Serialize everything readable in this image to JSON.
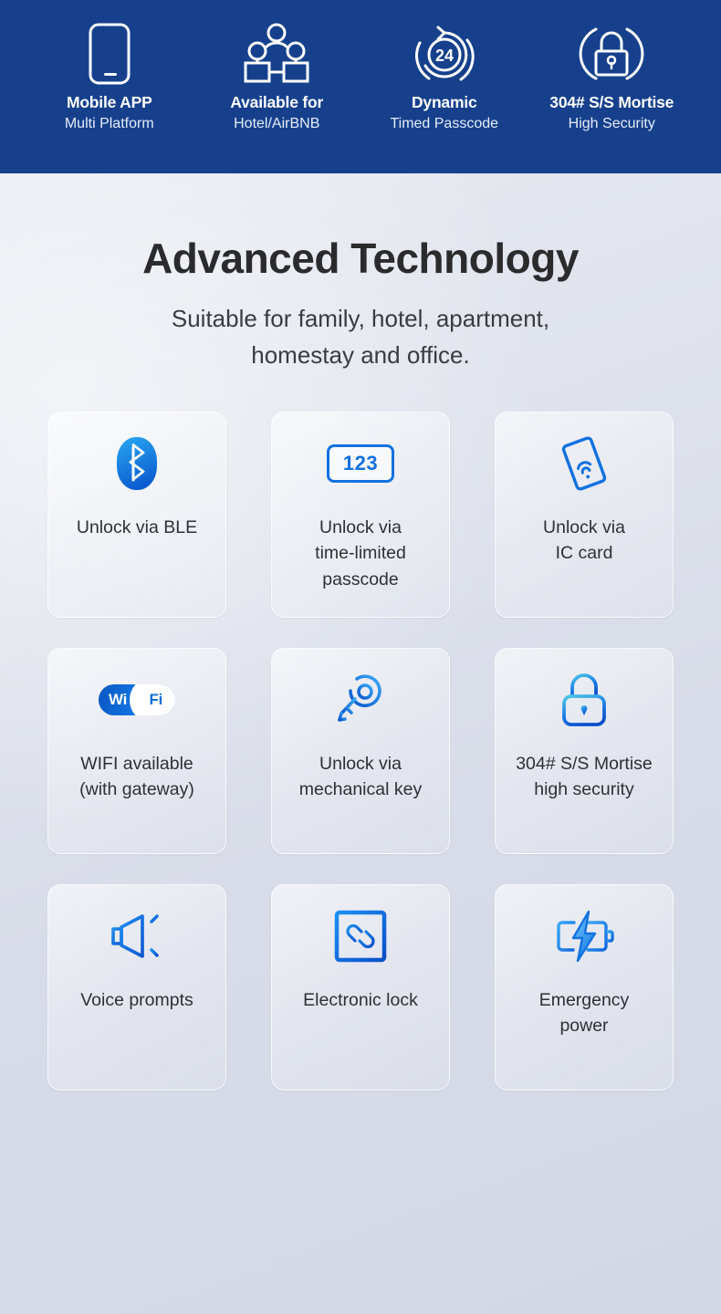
{
  "header": {
    "background_color": "#16408c",
    "items": [
      {
        "icon": "mobile-phone-icon",
        "title": "Mobile APP",
        "subtitle": "Multi Platform"
      },
      {
        "icon": "users-network-icon",
        "title": "Available for",
        "subtitle": "Hotel/AirBNB"
      },
      {
        "icon": "24-hour-cycle-icon",
        "title": "Dynamic",
        "subtitle": "Timed Passcode"
      },
      {
        "icon": "padlock-shield-icon",
        "title": "304# S/S Mortise",
        "subtitle": "High Security"
      }
    ],
    "badge_number": "24"
  },
  "hero": {
    "title": "Advanced Technology",
    "subtitle_line1": "Suitable for family, hotel, apartment,",
    "subtitle_line2": "homestay and office.",
    "title_color": "#2b2b2e"
  },
  "features": {
    "accent_color": "#1271e0",
    "cards": [
      {
        "icon": "bluetooth-icon",
        "lines": [
          "Unlock via BLE"
        ]
      },
      {
        "icon": "passcode-123-icon",
        "lines": [
          "Unlock via",
          "time-limited",
          "passcode"
        ],
        "code_text": "123"
      },
      {
        "icon": "ic-card-icon",
        "lines": [
          "Unlock via",
          "IC card"
        ]
      },
      {
        "icon": "wifi-logo-icon",
        "lines": [
          "WIFI available",
          "(with gateway)"
        ],
        "logo_left": "Wi",
        "logo_right": "Fi"
      },
      {
        "icon": "mechanical-key-icon",
        "lines": [
          "Unlock via",
          "mechanical key"
        ]
      },
      {
        "icon": "padlock-icon",
        "lines": [
          "304# S/S Mortise",
          "high security"
        ]
      },
      {
        "icon": "speaker-voice-icon",
        "lines": [
          "Voice prompts"
        ]
      },
      {
        "icon": "chain-link-icon",
        "lines": [
          "Electronic lock"
        ]
      },
      {
        "icon": "battery-bolt-icon",
        "lines": [
          "Emergency",
          "power"
        ]
      }
    ]
  }
}
